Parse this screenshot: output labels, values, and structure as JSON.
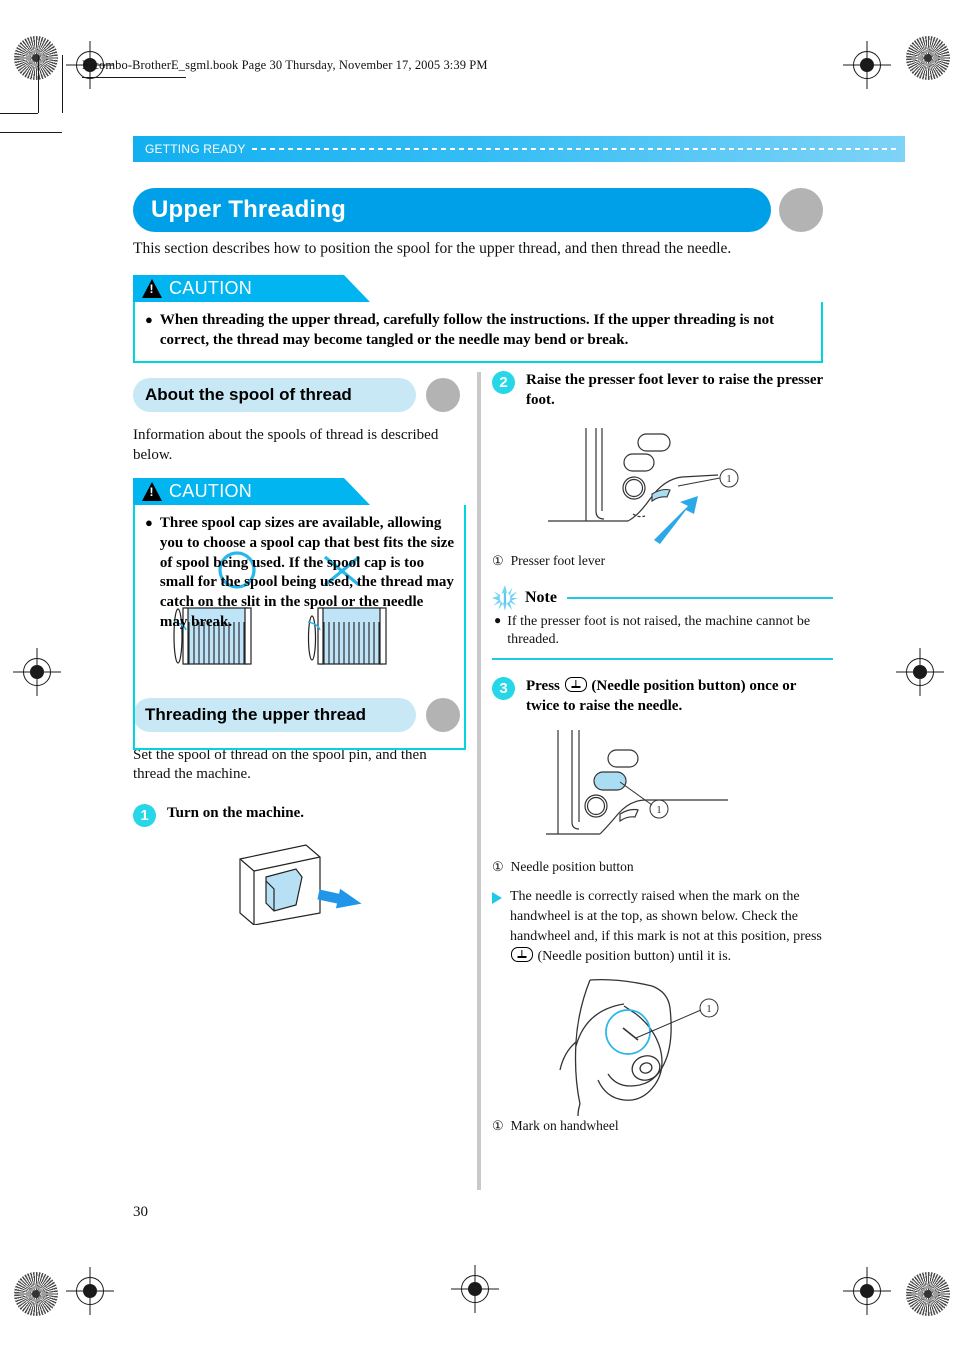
{
  "file_header": "F-combo-BrotherE_sgml.book  Page 30  Thursday, November 17, 2005  3:39 PM",
  "running_head": "GETTING READY",
  "title": "Upper Threading",
  "intro": "This section describes how to position the spool for the upper thread, and then thread the needle.",
  "page_number": "30",
  "colors": {
    "accent_blue": "#00a0e9",
    "caution_cyan": "#00b5f0",
    "caution_border": "#00d5e0",
    "subhead_fill": "#c8e8f5",
    "step_circle": "#26d7e8",
    "crescent_gray": "#b3b3b3",
    "note_rule": "#1ec8e6"
  },
  "caution_1": {
    "label": "CAUTION",
    "items": [
      "When threading the upper thread, carefully follow the instructions. If the upper threading is not correct, the thread may become tangled or the needle may bend or break."
    ]
  },
  "left_column": {
    "section_1": {
      "heading": "About the spool of thread",
      "body": "Information about the spools of thread is described below."
    },
    "caution_2": {
      "label": "CAUTION",
      "items": [
        "Three spool cap sizes are available, allowing you to choose a spool cap that best fits the size of spool being used. If the spool cap is too small for the spool being used, the thread may catch on the slit in the spool or the needle may break."
      ]
    },
    "spool_figure": {
      "good_mark": "circle",
      "bad_mark": "cross"
    },
    "section_2": {
      "heading": "Threading the upper thread",
      "body": "Set the spool of thread on the spool pin, and then thread the machine."
    },
    "step_1": {
      "number": "1",
      "text": "Turn on the machine.",
      "figure_name": "power-switch-illustration"
    }
  },
  "right_column": {
    "step_2": {
      "number": "2",
      "text": "Raise the presser foot lever to raise the presser foot.",
      "caption_num": "①",
      "caption": "Presser foot lever"
    },
    "note": {
      "title": "Note",
      "items": [
        "If the presser foot is not raised, the machine cannot be threaded."
      ]
    },
    "step_3": {
      "number": "3",
      "text_before": "Press",
      "text_after": "(Needle position button) once or twice to raise the needle.",
      "caption_num": "①",
      "caption": "Needle position button"
    },
    "tri_para": {
      "part1": "The needle is correctly raised when the mark on the handwheel is at the top, as shown below. Check the handwheel and, if this mark is not at this position, press",
      "part2": "(Needle position button) until it is."
    },
    "handwheel": {
      "caption_num": "①",
      "caption": "Mark on handwheel"
    }
  }
}
